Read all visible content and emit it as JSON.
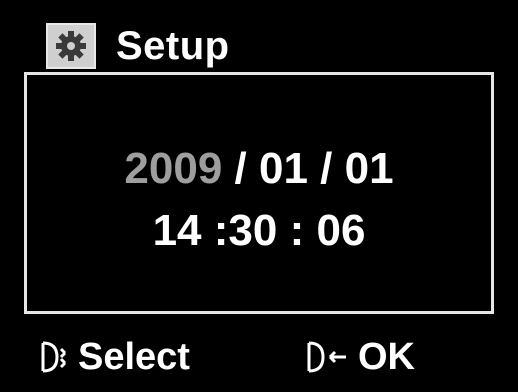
{
  "header": {
    "title": "Setup",
    "icon": "gear-icon"
  },
  "datetime": {
    "year": "2009",
    "month": "01",
    "day": "01",
    "hour": "14",
    "minute": "30",
    "second": "06",
    "date_separator": " / ",
    "time_separator_1": " :",
    "time_separator_2": " : ",
    "active_field": "year"
  },
  "footer": {
    "select_label": "Select",
    "select_icon": "select-arrows-icon",
    "ok_label": "OK",
    "ok_icon": "ok-arrow-icon"
  },
  "colors": {
    "background": "#000000",
    "text": "#ffffff",
    "active_field": "#9e9e9e",
    "icon_box": "#cfcfcf"
  }
}
